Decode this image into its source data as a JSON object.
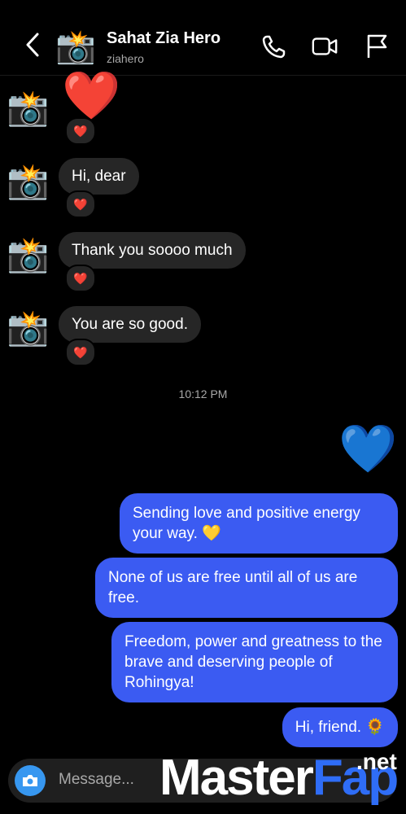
{
  "header": {
    "title": "Sahat Zia Hero",
    "username": "ziahero",
    "avatar_emoji": "📸",
    "icons": [
      "back-icon",
      "phone-icon",
      "video-icon",
      "flag-icon"
    ]
  },
  "incoming": [
    {
      "text": "❤️",
      "avatar": "📸",
      "reaction": "❤️"
    },
    {
      "text": "Hi, dear",
      "avatar": "📸",
      "reaction": "❤️"
    },
    {
      "text": "Thank you soooo much",
      "avatar": "📸",
      "reaction": "❤️"
    },
    {
      "text": "You are so good.",
      "avatar": "📸",
      "reaction": "❤️"
    }
  ],
  "timestamp": "10:12 PM",
  "outgoing": [
    {
      "text": "💙"
    },
    {
      "text": "Sending love and positive energy your way. 💛"
    },
    {
      "text": "None of us are free until all of us are free."
    },
    {
      "text": "Freedom, power and greatness to the brave and deserving people of Rohingya!"
    },
    {
      "text": "Hi, friend. 🌻"
    }
  ],
  "composer": {
    "placeholder": "Message..."
  },
  "watermark": {
    "part1": "Master",
    "part2": "Fap",
    "suffix": ".net"
  },
  "colors": {
    "outgoing_bubble": "#3b5bf2",
    "incoming_bubble": "#262626",
    "camera_button": "#3797f0"
  }
}
